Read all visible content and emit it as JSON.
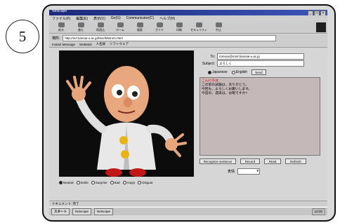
{
  "step_number": "5",
  "browser": {
    "menu": [
      "ファイル(F)",
      "編集(E)",
      "表示(V)",
      "Go(G)",
      "Communicator(C)",
      "ヘルプ(H)"
    ],
    "toolbar": [
      "戻る",
      "進む",
      "再読込",
      "ホーム",
      "検索",
      "ガイド",
      "印刷",
      "セキュリティ",
      "中止"
    ],
    "address_label": "場所:",
    "address_value": "http://mrl.kansai-u.ac.jp/face/Mstrom.html",
    "links": [
      "Instant Message",
      "WebMail",
      "人名録",
      "ソフトウェア"
    ],
    "status_text": "ドキュメント: 完了"
  },
  "form": {
    "to_label": "To:",
    "to_value": "mmxxx@mmrl.kansai-u.ac.jp",
    "subject_label": "Subject:",
    "subject_value": "よろしく",
    "lang_options": [
      "Japanese",
      "English"
    ],
    "send_button": "Send",
    "message_lines": [
      "こんにちは",
      "この前の試験は、ありがとう。",
      "今回も、よろしくお願いします。",
      "今度の、週末は、お暇ですか?"
    ],
    "buttons": [
      "Recognize sentence",
      "Record",
      "Read",
      "Refresh"
    ],
    "select_label": "表情",
    "select_value": ""
  },
  "expressions": [
    "Neutral",
    "Smile",
    "Surprise",
    "Sad",
    "Angry",
    "Disgust"
  ],
  "taskbar": {
    "start": "スタート",
    "tasks": [
      "Netscape",
      "Netscape"
    ],
    "tray": "12:00"
  }
}
